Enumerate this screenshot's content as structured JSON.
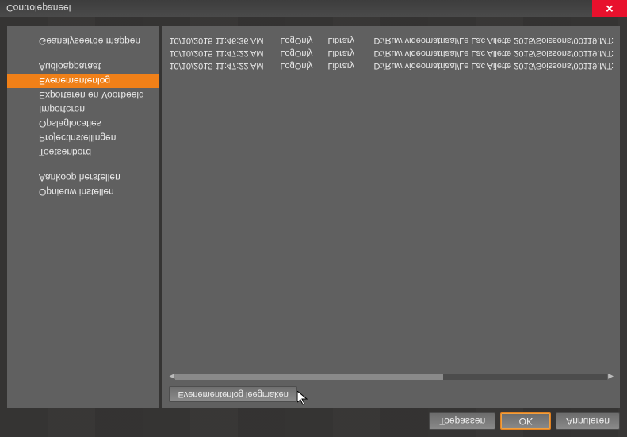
{
  "window": {
    "title": "Controlepaneel",
    "close": "✕"
  },
  "footer": {
    "apply": "Toepassen",
    "ok": "OK",
    "cancel": "Annuleren"
  },
  "toolbar": {
    "clear_log": "Evenementenlog leegmaken"
  },
  "sidebar": {
    "g1": [
      {
        "label": "Geanalyseerde mappen"
      }
    ],
    "g2": [
      {
        "label": "Audioapparaat"
      },
      {
        "label": "Evenementenlog",
        "active": true
      },
      {
        "label": "Exporteren en Voorbeeld"
      },
      {
        "label": "Importeren"
      },
      {
        "label": "Opslaglocaties"
      },
      {
        "label": "Projectinstellingen"
      },
      {
        "label": "Toetsenbord"
      }
    ],
    "g3": [
      {
        "label": "Aankoop herstellen"
      },
      {
        "label": "Opnieuw instellen"
      }
    ]
  },
  "log": {
    "rows": [
      {
        "time": "10/10/2015 11:46:36 AM",
        "level": "LogOnly",
        "area": "Library",
        "msg": "'D:/Ruw videomatriaal/Le Lac Ailette 2015/Soissons/00119.MT:"
      },
      {
        "time": "10/10/2015 11:47:22 AM",
        "level": "LogOnly",
        "area": "Library",
        "msg": "'D:/Ruw videomatriaal/Le Lac Ailette 2015/Soissons/00119.MT:"
      },
      {
        "time": "10/10/2015 11:47:22 AM",
        "level": "LogOnly",
        "area": "Library",
        "msg": "'D:/Ruw videomatriaal/Le Lac Ailette 2015/Soissons/00119.MT:"
      }
    ]
  }
}
